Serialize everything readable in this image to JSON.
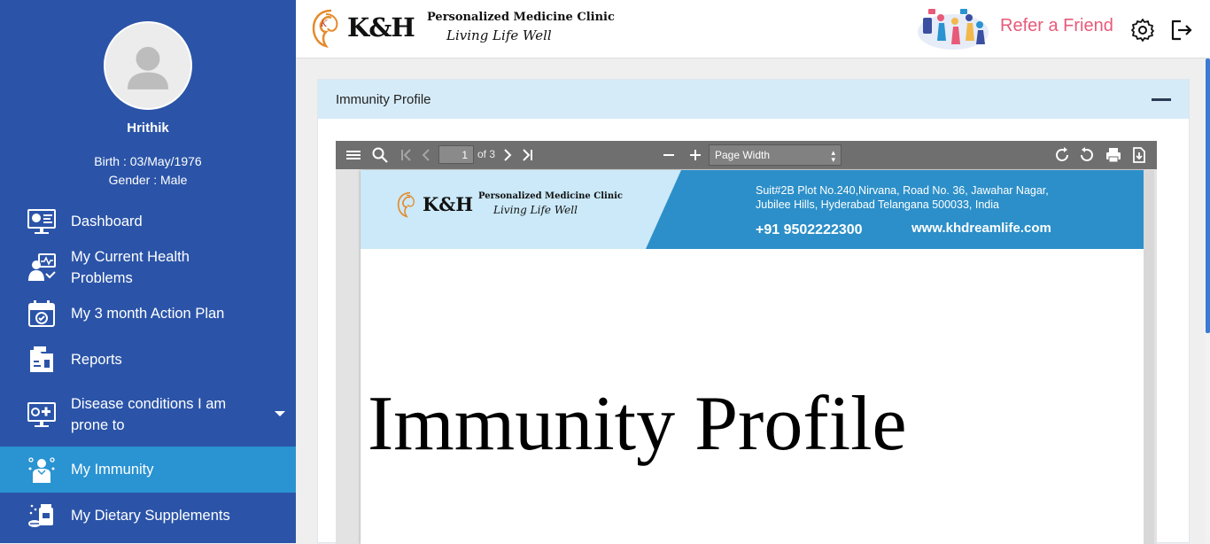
{
  "user": {
    "name": "Hrithik",
    "birth": "Birth : 03/May/1976",
    "gender": "Gender : Male"
  },
  "sidebar": {
    "items": [
      {
        "label": "Dashboard",
        "icon": "dashboard-icon"
      },
      {
        "label": "My Current Health Problems",
        "icon": "health-problems-icon"
      },
      {
        "label": "My 3 month Action Plan",
        "icon": "calendar-check-icon"
      },
      {
        "label": "Reports",
        "icon": "reports-icon"
      },
      {
        "label": "Disease conditions I am prone to",
        "icon": "disease-monitor-icon"
      },
      {
        "label": "My Immunity",
        "icon": "immunity-icon",
        "active": true
      },
      {
        "label": "My Dietary Supplements",
        "icon": "supplements-icon"
      }
    ]
  },
  "header": {
    "logo": "K&H",
    "tagline": "Personalized Medicine Clinic",
    "tagline2": "Living Life Well",
    "refer": "Refer a Friend"
  },
  "card": {
    "title": "Immunity Profile"
  },
  "pdf": {
    "page_number": "1",
    "page_of": "of 3",
    "zoom": "Page Width",
    "banner": {
      "logo": "K&H",
      "tagline": "Personalized Medicine Clinic",
      "tagline2": "Living Life Well",
      "address1": "Suit#2B Plot No.240,Nirvana, Road No. 36, Jawahar Nagar,",
      "address2": "Jubilee Hills, Hyderabad Telangana 500033, India",
      "phone": "+91 9502222300",
      "website": "www.khdreamlife.com"
    },
    "heading": "Immunity Profile"
  },
  "colors": {
    "sidebar": "#2b54a8",
    "active": "#2a93d2",
    "refer": "#e85a78",
    "card_header": "#d6ebf8"
  }
}
